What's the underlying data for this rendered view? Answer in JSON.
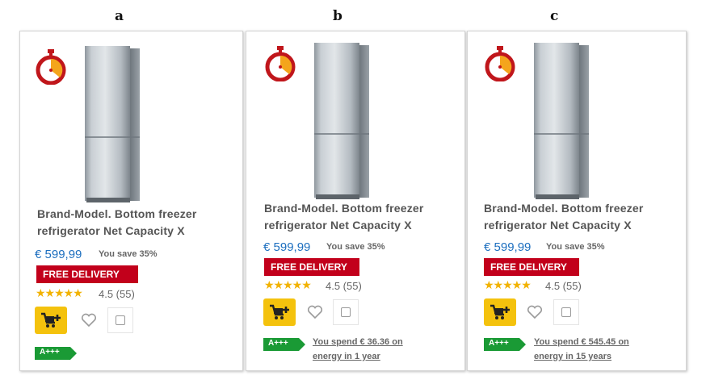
{
  "panels": [
    {
      "letter": "a",
      "product_title_line1": "Brand-Model. Bottom freezer",
      "product_title_line2": "refrigerator Net Capacity X",
      "price": "€ 599,99",
      "savings": "You save 35%",
      "delivery_badge": "FREE DELIVERY",
      "stars_text": "★★★★★",
      "rating_value": 4.5,
      "rating_text": "4.5 (55)",
      "energy_label": "A+++"
    },
    {
      "letter": "b",
      "product_title_line1": "Brand-Model. Bottom freezer",
      "product_title_line2": "refrigerator Net Capacity X",
      "price": "€ 599,99",
      "savings": "You save 35%",
      "delivery_badge": "FREE DELIVERY",
      "stars_text": "★★★★★",
      "rating_value": 4.5,
      "rating_text": "4.5 (55)",
      "energy_label": "A+++",
      "energy_cost_line1": "You spend € 36.36 on",
      "energy_cost_line2": "energy in 1 year"
    },
    {
      "letter": "c",
      "product_title_line1": "Brand-Model. Bottom freezer",
      "product_title_line2": "refrigerator Net Capacity X",
      "price": "€ 599,99",
      "savings": "You save 35%",
      "delivery_badge": "FREE DELIVERY",
      "stars_text": "★★★★★",
      "rating_value": 4.5,
      "rating_text": "4.5 (55)",
      "energy_label": "A+++",
      "energy_cost_line1": "You spend € 545.45 on",
      "energy_cost_line2": "energy in 15 years"
    }
  ],
  "icons": {
    "timer": "stopwatch-icon",
    "cart": "add-to-cart-icon",
    "wishlist": "heart-icon",
    "compare": "compare-checkbox-icon"
  },
  "colors": {
    "price": "#1d6fbf",
    "delivery_badge": "#c2001b",
    "cart_button": "#f4c20d",
    "energy_label": "#1a9a35",
    "stars": "#f2b200",
    "timer_red": "#c0161b",
    "timer_orange": "#f4a51c"
  }
}
